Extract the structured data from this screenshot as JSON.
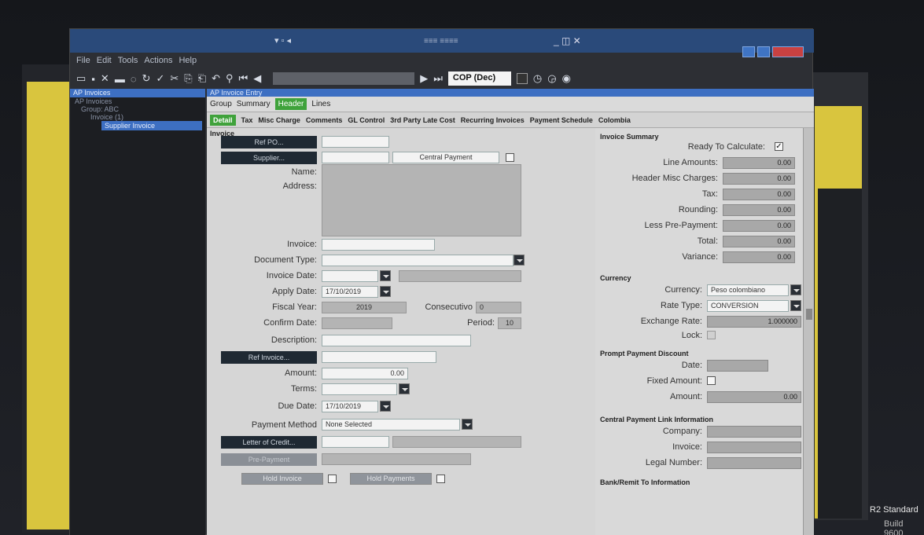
{
  "colors": {
    "accent": "#3d6fc2",
    "active_tab": "#3fa23b",
    "close_button": "#c94141",
    "side_panel": "#d9c53e"
  },
  "window": {
    "title": "AP Invoice Entry"
  },
  "menu": [
    "File",
    "Edit",
    "Tools",
    "Actions",
    "Help"
  ],
  "toolbar": {
    "currency_select": "COP (Dec)"
  },
  "tree": {
    "header": "AP Invoices",
    "items": [
      "AP Invoices",
      "Group: ABC",
      "Invoice (1)"
    ],
    "selected": "Supplier Invoice"
  },
  "entry_header": "AP Invoice Entry",
  "tabs_level1": [
    "Group",
    "Summary",
    "Header",
    "Lines"
  ],
  "tabs_level1_active": "Header",
  "tabs_level2": [
    "Detail",
    "Tax",
    "Misc Charge",
    "Comments",
    "GL Control",
    "3rd Party Late Cost",
    "Recurring Invoices",
    "Payment Schedule",
    "Colombia"
  ],
  "tabs_level2_active": "Detail",
  "invoice": {
    "section": "Invoice",
    "ref_po_btn": "Ref PO...",
    "supplier_btn": "Supplier...",
    "central_payment_btn": "Central Payment",
    "name_label": "Name:",
    "address_label": "Address:",
    "invoice_label": "Invoice:",
    "document_type_label": "Document Type:",
    "invoice_date_label": "Invoice Date:",
    "apply_date_label": "Apply Date:",
    "apply_date": "17/10/2019",
    "fiscal_year_label": "Fiscal Year:",
    "fiscal_year": "2019",
    "consecutivo_label": "Consecutivo",
    "consecutivo": "0",
    "confirm_date_label": "Confirm Date:",
    "period_label": "Period:",
    "period": "10",
    "description_label": "Description:",
    "ref_invoice_btn": "Ref Invoice...",
    "amount_label": "Amount:",
    "amount": "0.00",
    "terms_label": "Terms:",
    "due_date_label": "Due Date:",
    "due_date": "17/10/2019",
    "payment_method_label": "Payment Method",
    "payment_method": "None Selected",
    "letter_of_credit_btn": "Letter of Credit...",
    "pre_payment_btn": "Pre-Payment",
    "hold_invoice_btn": "Hold Invoice",
    "hold_payments_btn": "Hold Payments"
  },
  "summary": {
    "section": "Invoice Summary",
    "ready_label": "Ready To Calculate:",
    "rows": [
      {
        "label": "Line Amounts:",
        "value": "0.00"
      },
      {
        "label": "Header Misc Charges:",
        "value": "0.00"
      },
      {
        "label": "Tax:",
        "value": "0.00"
      },
      {
        "label": "Rounding:",
        "value": "0.00"
      },
      {
        "label": "Less Pre-Payment:",
        "value": "0.00"
      },
      {
        "label": "Total:",
        "value": "0.00"
      },
      {
        "label": "Variance:",
        "value": "0.00"
      }
    ]
  },
  "currency": {
    "section": "Currency",
    "currency_label": "Currency:",
    "currency": "Peso colombiano",
    "rate_type_label": "Rate Type:",
    "rate_type": "CONVERSION",
    "exchange_rate_label": "Exchange Rate:",
    "exchange_rate": "1.000000",
    "lock_label": "Lock:"
  },
  "prompt_payment": {
    "section": "Prompt Payment Discount",
    "date_label": "Date:",
    "fixed_amount_label": "Fixed Amount:",
    "amount_label": "Amount:",
    "amount": "0.00"
  },
  "central_link": {
    "section": "Central Payment Link Information",
    "company_label": "Company:",
    "invoice_label": "Invoice:",
    "legal_number_label": "Legal Number:"
  },
  "bank_remit": {
    "section": "Bank/Remit To Information"
  },
  "desktop": {
    "edition": "R2 Standard",
    "build": "Build 9600"
  }
}
